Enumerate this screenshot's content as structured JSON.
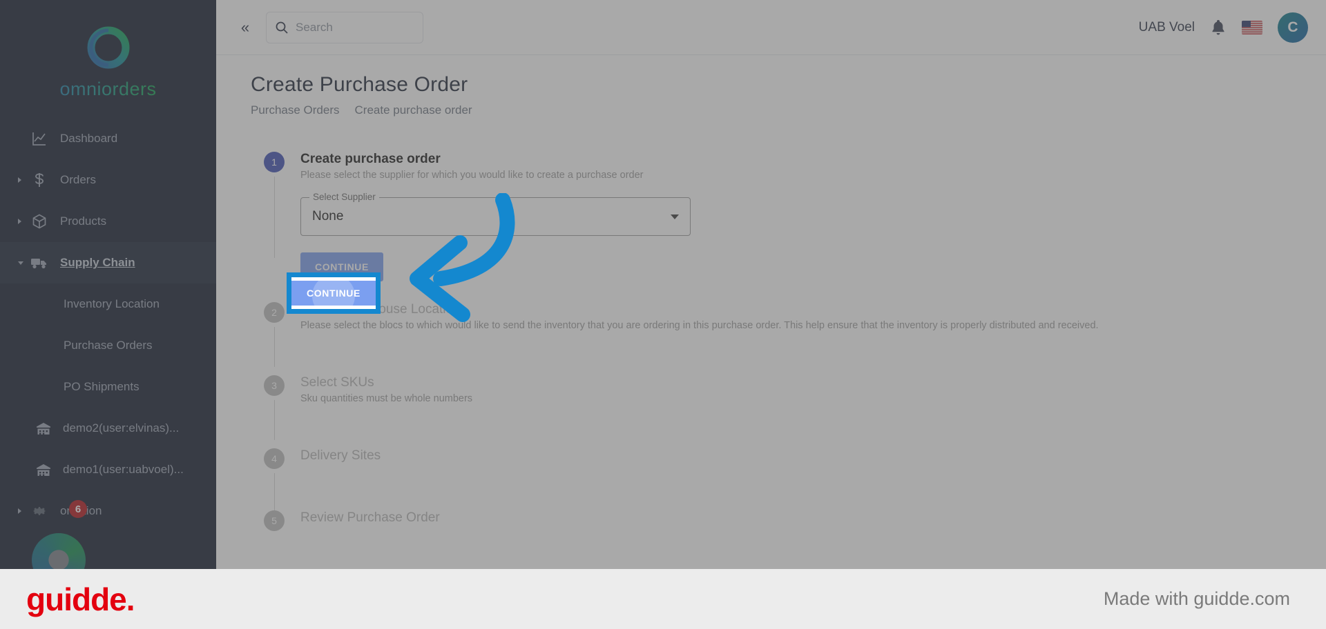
{
  "brand": {
    "name": "omniorders",
    "logo_icon": "omniorders-ring-logo"
  },
  "header": {
    "collapse_icon": "double-chevron-left-icon",
    "search": {
      "placeholder": "Search",
      "value": "",
      "icon": "search-icon"
    },
    "company": "UAB Voel",
    "notification_icon": "bell-icon",
    "language_flag": "us-flag-icon",
    "avatar_initial": "C"
  },
  "sidebar": {
    "items": [
      {
        "label": "Dashboard",
        "icon": "chart-line-icon",
        "expandable": false,
        "active": false
      },
      {
        "label": "Orders",
        "icon": "dollar-icon",
        "expandable": true,
        "active": false
      },
      {
        "label": "Products",
        "icon": "box-icon",
        "expandable": true,
        "active": false
      },
      {
        "label": "Supply Chain",
        "icon": "truck-icon",
        "expandable": true,
        "active": true
      }
    ],
    "sub_items": [
      {
        "label": "Inventory Location"
      },
      {
        "label": "Purchase Orders"
      },
      {
        "label": "PO Shipments"
      }
    ],
    "warehouses": [
      {
        "label": "demo2(user:elvinas)...",
        "icon": "warehouse-icon"
      },
      {
        "label": "demo1(user:uabvoel)...",
        "icon": "warehouse-icon"
      }
    ],
    "automation": {
      "label": "omation",
      "icon": "gear-icon",
      "badge": "6"
    }
  },
  "page": {
    "title": "Create Purchase Order",
    "breadcrumb": [
      "Purchase Orders",
      "Create purchase order"
    ]
  },
  "stepper": {
    "steps": [
      {
        "number": "1",
        "title": "Create purchase order",
        "subtitle": "Please select the supplier for which you would like to create a purchase order",
        "active": true
      },
      {
        "number": "2",
        "title": "Select Warehouse Location",
        "subtitle": "Please select the blocs to which would like to send the inventory that you are ordering in this purchase order. This help ensure that the inventory is properly distributed and received.",
        "active": false
      },
      {
        "number": "3",
        "title": "Select SKUs",
        "subtitle": "Sku quantities must be whole numbers",
        "active": false
      },
      {
        "number": "4",
        "title": "Delivery Sites",
        "subtitle": "",
        "active": false
      },
      {
        "number": "5",
        "title": "Review Purchase Order",
        "subtitle": "",
        "active": false
      }
    ]
  },
  "form": {
    "supplier_label": "Select Supplier",
    "supplier_value": "None",
    "dropdown_icon": "chevron-down-icon",
    "continue_label": "CONTINUE"
  },
  "annotation": {
    "highlight_target": "CONTINUE",
    "highlight_color": "#1488cf",
    "arrow_icon": "curved-arrow-left-icon"
  },
  "footer": {
    "logo": "guidde.",
    "made_with": "Made with guidde.com",
    "logo_color": "#e3000f"
  }
}
